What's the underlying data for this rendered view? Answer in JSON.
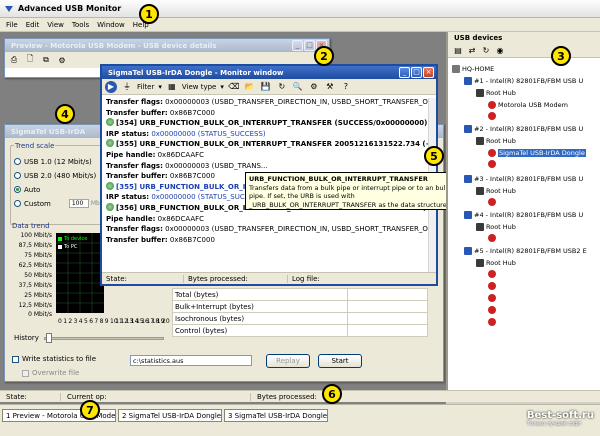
{
  "app": {
    "title": "Advanced USB Monitor"
  },
  "menu": [
    "File",
    "Edit",
    "View",
    "Tools",
    "Window",
    "Help"
  ],
  "preview_window": {
    "title": "Preview - Motorola USB Modem - USB device details"
  },
  "stats_window": {
    "title": "SigmaTel USB-IrDA"
  },
  "monitor": {
    "title": "SigmaTel USB-IrDA Dongle - Monitor window",
    "filter_label": "Filter",
    "view_type_label": "View type",
    "rows": [
      {
        "k": "Transfer flags:",
        "v": " 0x00000003 (USBD_TRANSFER_DIRECTION_IN, USBD_SHORT_TRANSFER_OK)"
      },
      {
        "k": "Transfer buffer:",
        "v": " 0x86B7C000"
      },
      {
        "k": "",
        "v": "[354] URB_FUNCTION_BULK_OR_INTERRUPT_TRANSFER (SUCCESS/0x00000000) 20051216131...",
        "pkt": true
      },
      {
        "k": "IRP status:",
        "v": " 0x00000000 (STATUS_SUCCESS)",
        "blue": true
      },
      {
        "k": "",
        "v": "[355] URB_FUNCTION_BULK_OR_INTERRUPT_TRANSFER 20051216131522.734 (+16)",
        "pkt": true
      },
      {
        "k": "Pipe handle:",
        "v": " 0x86DCAAFC"
      },
      {
        "k": "Transfer flags:",
        "v": " 0x00000003 (USBD_TRANS..."
      },
      {
        "k": "Transfer buffer:",
        "v": " 0x86B7C000"
      },
      {
        "k": "",
        "v": "[355] URB_FUNCTION_BULK_OR_INTERRUPT_TRANSFER...",
        "pkt": true,
        "blue": true
      },
      {
        "k": "IRP status:",
        "v": " 0x00000000 (STATUS_SUCCESS)",
        "blue": true
      },
      {
        "k": "",
        "v": "[356] URB_FUNCTION_BULK_OR_INTERRUPT_TRANSFER 20051216131522.750 (+16)",
        "pkt": true
      },
      {
        "k": "Pipe handle:",
        "v": " 0x86DCAAFC"
      },
      {
        "k": "Transfer flags:",
        "v": " 0x00000003 (USBD_TRANSFER_DIRECTION_IN, USBD_SHORT_TRANSFER_OK)"
      },
      {
        "k": "Transfer buffer:",
        "v": " 0x86B7C000"
      }
    ],
    "status": {
      "state": "State:",
      "bytes": "Bytes processed:",
      "log": "Log file:"
    }
  },
  "tooltip": {
    "title": "URB_FUNCTION_BULK_OR_INTERRUPT_TRANSFER",
    "text": "Transfers data from a bulk pipe or interrupt pipe or to an bulk pipe. If set, the URB is used with _URB_BULK_OR_INTERRUPT_TRANSFER as the data structure."
  },
  "trend": {
    "label": "Trend scale",
    "options": [
      "USB 1.0 (12 Mbit/s)",
      "USB 2.0 (480 Mbit/s)",
      "Auto",
      "Custom"
    ],
    "selected_index": 2,
    "custom_value": "100",
    "custom_unit": "Mbit/s"
  },
  "data_trend": {
    "label": "Data trend",
    "legend": [
      "To device",
      "To PC"
    ],
    "y_ticks": [
      "100 Mbit/s",
      "87,5 Mbit/s",
      "75 Mbit/s",
      "62,5 Mbit/s",
      "50 Mbit/s",
      "37,5 Mbit/s",
      "25 Mbit/s",
      "12,5 Mbit/s",
      "0 Mbit/s"
    ],
    "x_ticks": [
      "0",
      "1",
      "2",
      "3",
      "4",
      "5",
      "6",
      "7",
      "8",
      "9",
      "10",
      "11",
      "12",
      "13",
      "14",
      "15",
      "16",
      "17",
      "18",
      "19",
      "20"
    ],
    "history_label": "History"
  },
  "stats_rows": [
    "Total (bytes)",
    "Bulk+Interrupt (bytes)",
    "Isochronous (bytes)",
    "Control (bytes)"
  ],
  "write_stats": {
    "label": "Write statistics to file",
    "path": "c:\\statistics.aus",
    "overwrite": "Overwrite file"
  },
  "buttons": {
    "replay": "Replay",
    "start": "Start"
  },
  "app_status": {
    "state": "State:",
    "current_op": "Current op:",
    "bytes": "Bytes processed:"
  },
  "tasks": [
    "1 Preview - Motorola USB Mode...",
    "2 SigmaTel USB-IrDA Dongle - ...",
    "3 SigmaTel USB-IrDA Dongle - ..."
  ],
  "usb_panel": {
    "title": "USB devices",
    "tree": [
      {
        "label": "HQ-HOME",
        "depth": 0
      },
      {
        "label": "#1 - Intel(R) 82801FB/FBM USB U",
        "depth": 1
      },
      {
        "label": "Root Hub",
        "depth": 2
      },
      {
        "label": "Motorola USB Modem",
        "depth": 3
      },
      {
        "label": "#2 - Intel(R) 82801FB/FBM USB U",
        "depth": 1
      },
      {
        "label": "Root Hub",
        "depth": 2
      },
      {
        "label": "SigmaTel USB-IrDA Dongle",
        "depth": 3,
        "selected": true
      },
      {
        "label": "#3 - Intel(R) 82801FB/FBM USB U",
        "depth": 1
      },
      {
        "label": "Root Hub",
        "depth": 2
      },
      {
        "label": "#4 - Intel(R) 82801FB/FBM USB U",
        "depth": 1
      },
      {
        "label": "Root Hub",
        "depth": 2
      },
      {
        "label": "#5 - Intel(R) 82801FB/FBM USB2 E",
        "depth": 1
      },
      {
        "label": "Root Hub",
        "depth": 2
      }
    ]
  },
  "callouts": [
    "1",
    "2",
    "3",
    "4",
    "5",
    "6",
    "7"
  ],
  "watermark": {
    "brand": "Best-soft.ru",
    "tagline": "Только лучшие софт"
  },
  "colors": {
    "title_active": "#1e4ca0",
    "selection": "#316ac5",
    "callout": "#ffe600",
    "tooltip_bg": "#ffffe1"
  }
}
